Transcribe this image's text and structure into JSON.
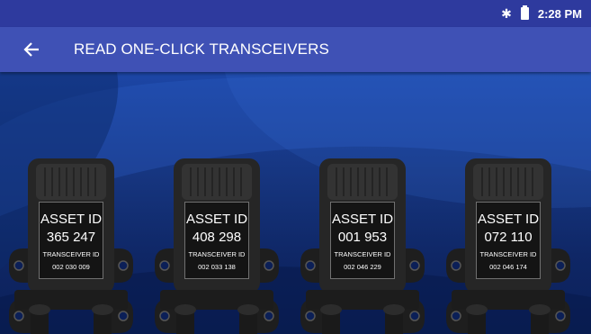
{
  "status_bar": {
    "time": "2:28 PM",
    "bluetooth_icon": "bluetooth-icon",
    "battery_icon": "battery-icon"
  },
  "app_bar": {
    "back_icon": "arrow-back-icon",
    "title": "READ ONE-CLICK TRANSCEIVERS"
  },
  "devices": [
    {
      "asset_label": "ASSET ID",
      "asset_id": "365 247",
      "transceiver_label": "TRANSCEIVER ID",
      "transceiver_id": "002 030 009"
    },
    {
      "asset_label": "ASSET ID",
      "asset_id": "408 298",
      "transceiver_label": "TRANSCEIVER ID",
      "transceiver_id": "002 033 138"
    },
    {
      "asset_label": "ASSET ID",
      "asset_id": "001 953",
      "transceiver_label": "TRANSCEIVER ID",
      "transceiver_id": "002 046 229"
    },
    {
      "asset_label": "ASSET ID",
      "asset_id": "072 110",
      "transceiver_label": "TRANSCEIVER ID",
      "transceiver_id": "002 046 174"
    }
  ],
  "colors": {
    "status_bar": "#2e3a9e",
    "app_bar": "#3f51b5",
    "background": "#16357f"
  }
}
